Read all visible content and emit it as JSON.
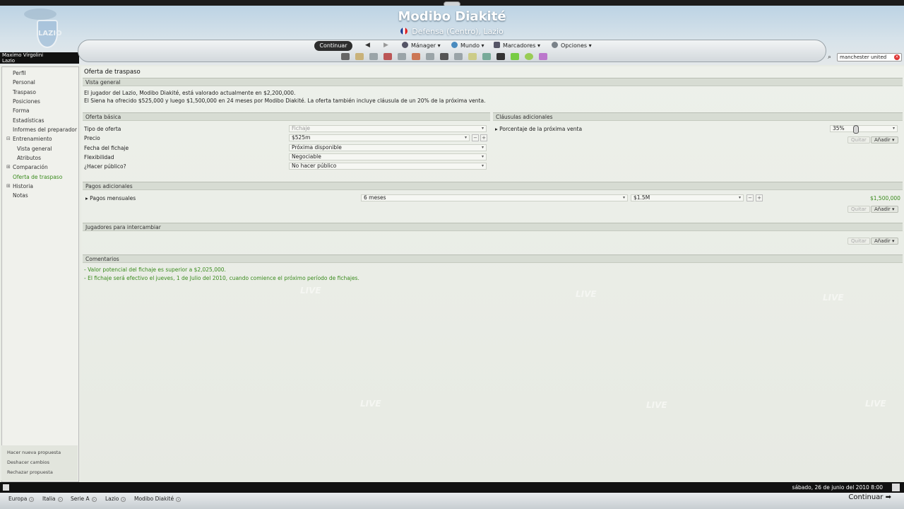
{
  "header": {
    "player_name": "Modibo Diakité",
    "player_sub": "Defensa (Centro), Lazio",
    "manager_name": "Maximo Virgolini",
    "manager_club": "Lazio",
    "crest_text": "LAZIO"
  },
  "nav": {
    "continue_label": "Continuar",
    "menus": [
      {
        "label": "Mánager",
        "icon": "person-icon"
      },
      {
        "label": "Mundo",
        "icon": "globe-icon"
      },
      {
        "label": "Marcadores",
        "icon": "bookmark-icon"
      },
      {
        "label": "Opciones",
        "icon": "gear-icon"
      }
    ],
    "search_value": "manchester united"
  },
  "sidebar": {
    "items": [
      {
        "label": "Perfil"
      },
      {
        "label": "Personal"
      },
      {
        "label": "Traspaso"
      },
      {
        "label": "Posiciones"
      },
      {
        "label": "Forma"
      },
      {
        "label": "Estadísticas"
      },
      {
        "label": "Informes del preparador"
      },
      {
        "label": "Entrenamiento"
      },
      {
        "label": "Vista general"
      },
      {
        "label": "Atributos"
      },
      {
        "label": "Comparación"
      },
      {
        "label": "Oferta de traspaso"
      },
      {
        "label": "Historia"
      },
      {
        "label": "Notas"
      }
    ],
    "actions": [
      "Hacer nueva propuesta",
      "Deshacer cambios",
      "Rechazar propuesta"
    ]
  },
  "main": {
    "title": "Oferta de traspaso",
    "overview_title": "Vista general",
    "overview_line1": "El jugador del Lazio, Modibo Diakité, está valorado actualmente en $2,200,000.",
    "overview_line2": "El Siena ha ofrecido $525,000 y luego $1,500,000 en 24 meses por Modibo Diakité. La oferta también incluye cláusula de un 20% de la próxima venta.",
    "basic_title": "Oferta básica",
    "basic_rows": [
      {
        "label": "Tipo de oferta",
        "value": "Fichaje"
      },
      {
        "label": "Precio",
        "value": "$525m"
      },
      {
        "label": "Fecha del fichaje",
        "value": "Próxima disponible"
      },
      {
        "label": "Flexibilidad",
        "value": "Negociable"
      },
      {
        "label": "¿Hacer público?",
        "value": "No hacer público"
      }
    ],
    "clauses_title": "Cláusulas adicionales",
    "clause_label": "Porcentaje de la próxima venta",
    "clause_value": "35%",
    "remove_label": "Quitar",
    "add_label": "Añadir",
    "payments_title": "Pagos adicionales",
    "monthly_label": "Pagos mensuales",
    "monthly_months": "6 meses",
    "monthly_amount": "$1.5M",
    "monthly_total": "$1,500,000",
    "swap_title": "Jugadores para intercambiar",
    "comments_title": "Comentarios",
    "comment1": "- Valor potencial del fichaje es superior a $2,025,000.",
    "comment2": "- El fichaje será efectivo el jueves, 1 de Julio del 2010, cuando comience el próximo período de fichajes.",
    "bg_word": "LIVE"
  },
  "status": {
    "date": "sábado, 26 de junio del 2010 8:00"
  },
  "breadcrumb": [
    "Europa",
    "Italia",
    "Serie A",
    "Lazio",
    "Modibo Diakité"
  ],
  "bottom_continue": "Continuar",
  "colors": {
    "accent_green": "#3a8b1d",
    "section_header": "#d7dcd3",
    "bar_dark": "#111111"
  }
}
